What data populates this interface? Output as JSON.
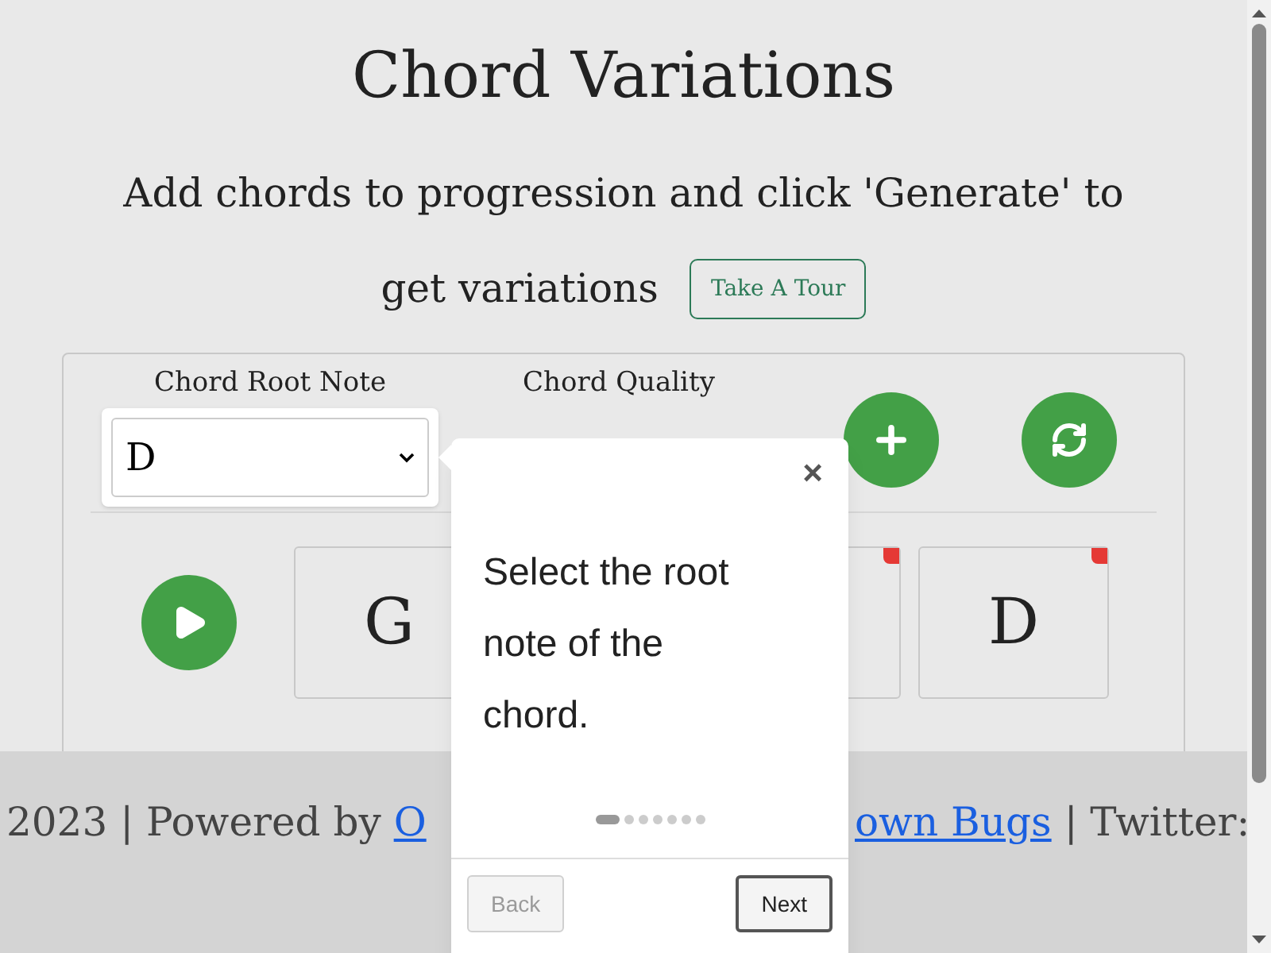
{
  "header": {
    "title": "Chord Variations",
    "subtitle_lines": [
      "Add chords to progression and click 'Generate' to",
      "get variations"
    ],
    "tour_button": "Take A Tour"
  },
  "controls": {
    "root_label": "Chord Root Note",
    "root_value": "D",
    "root_highlighted": true,
    "quality_label": "Chord Quality"
  },
  "cards": [
    {
      "label": "G"
    },
    {
      "flagged": true
    },
    {
      "label": "D",
      "flagged": true
    }
  ],
  "footer": {
    "before": "2023 | Powered by",
    "link_start": "O",
    "link_end": "own Bugs",
    "after": "| Twitter:"
  },
  "tour": {
    "close": "×",
    "text": "Select the root note of the chord.",
    "steps": [
      {
        "selected": true
      },
      {
        "selected": false
      },
      {
        "selected": false
      },
      {
        "selected": false
      },
      {
        "selected": false
      },
      {
        "selected": false
      },
      {
        "selected": false
      }
    ],
    "back": {
      "label": "Back",
      "disabled": true
    },
    "next": {
      "label": "Next",
      "disabled": false
    }
  }
}
